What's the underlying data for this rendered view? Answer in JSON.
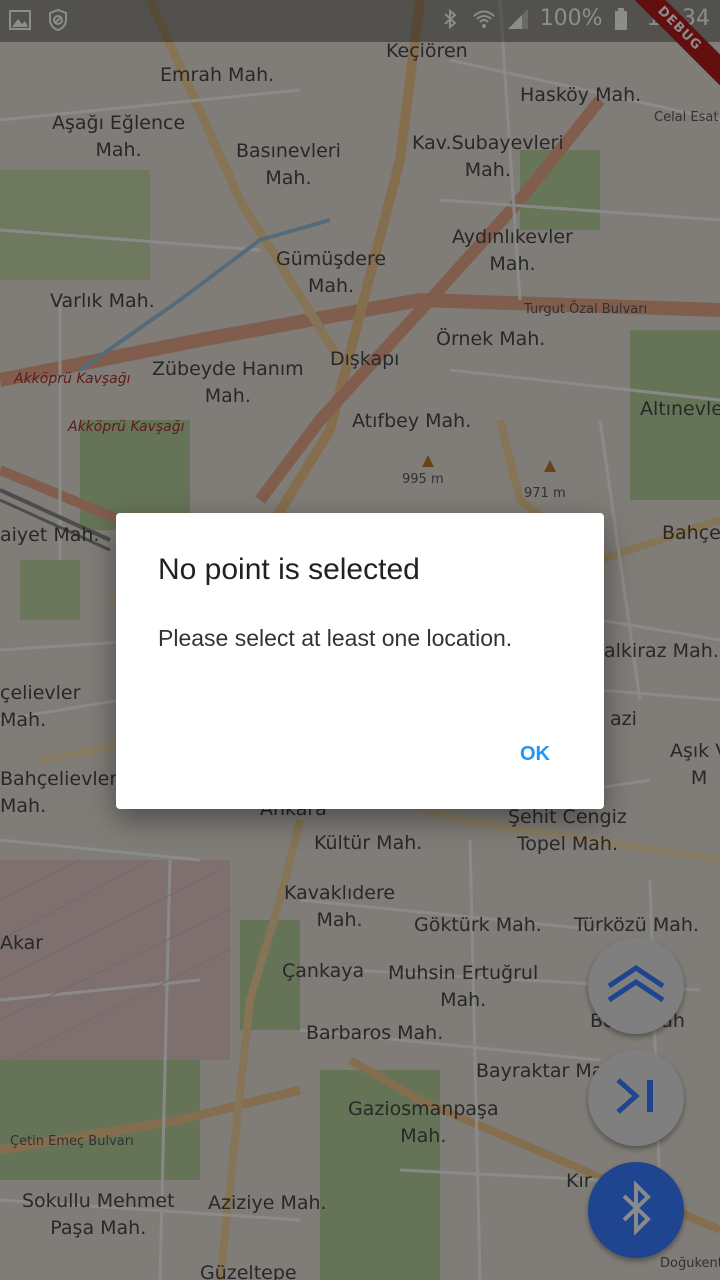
{
  "status_bar": {
    "battery": "100%",
    "time": "11:34",
    "left_icons": [
      "image-icon",
      "blocked-icon"
    ],
    "right_icons": [
      "bluetooth-icon",
      "wifi-icon",
      "signal-icon",
      "battery-icon"
    ]
  },
  "debug_banner": "DEBUG",
  "map": {
    "labels": {
      "kecioren": "Keçiören",
      "emrah": "Emrah Mah.",
      "haskoy": "Hasköy Mah.",
      "asagi_eglence": "Aşağı Eğlence\nMah.",
      "basinevleri": "Basınevleri\nMah.",
      "kav_subayevleri": "Kav.Subayevleri\nMah.",
      "celal_esat": "Celal Esat",
      "aydinlikevler": "Aydınlıkevler\nMah.",
      "gumusdere": "Gümüşdere\nMah.",
      "varlik": "Varlık Mah.",
      "turgut_ozal": "Turgut Özal Bulvarı",
      "ornek": "Örnek Mah.",
      "zubeyde": "Zübeyde Hanım\nMah.",
      "diskapi": "Dışkapı",
      "akkopru1": "Akköprü Kavşağı",
      "akkopru2": "Akköprü Kavşağı",
      "atifbey": "Atıfbey Mah.",
      "altinevler": "Altınevle",
      "elev995": "995 m",
      "elev971": "971 m",
      "aiyet": "aiyet Mah.",
      "bahce": "Bahçe",
      "calkiraz": "alkiraz Mah.",
      "celievler": "çelievler\nMah.",
      "azi": "azi",
      "asik": "Aşık V\nM",
      "bahcelievler": "Bahçelievler\nMah.",
      "ankara": "Ankara",
      "sehit_cengiz": "Şehit Cengiz\nTopel Mah.",
      "kultur": "Kültür Mah.",
      "kavaklidere": "Kavaklıdere\nMah.",
      "gokturk": "Göktürk Mah.",
      "turkozu": "Türközü Mah.",
      "akar": "Akar",
      "cankaya": "Çankaya",
      "muhsin": "Muhsin Ertuğrul\nMah.",
      "barbaros": "Barbaros Mah.",
      "b_mah": "Bo     Mah",
      "bayraktar": "Bayraktar Mah.",
      "gaziosmanpasa": "Gaziosmanpaşa\nMah.",
      "cetin_emec": "Çetin Emeç Bulvarı",
      "sokullu": "Sokullu Mehmet\nPaşa Mah.",
      "aziziye": "Aziziye Mah.",
      "kirk": "Kır     ar",
      "guzeltepe": "Güzeltepe",
      "dogukent": "Doğukent"
    }
  },
  "dialog": {
    "title": "No point is selected",
    "message": "Please select at least one location.",
    "ok_label": "OK"
  },
  "fabs": [
    {
      "icon": "route-icon",
      "color": "#7f7f7f"
    },
    {
      "icon": "skip-to-end-icon",
      "color": "#7f7f7f"
    },
    {
      "icon": "bluetooth-icon",
      "color": "#1f4591"
    }
  ],
  "colors": {
    "accent": "#2196f3",
    "fab_blue": "#1f4591",
    "debug_red": "#b71c1c"
  }
}
